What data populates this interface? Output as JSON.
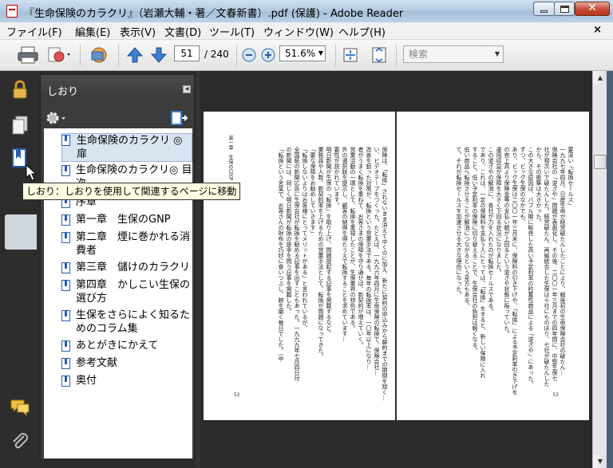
{
  "window": {
    "title": "『生命保険のカラクリ』（岩瀬大輔・著／文春新書）.pdf (保護) - Adobe Reader"
  },
  "menu": {
    "items": [
      "ファイル(F)",
      "編集(E)",
      "表示(V)",
      "文書(D)",
      "ツール(T)",
      "ウィンドウ(W)",
      "ヘルプ(H)"
    ],
    "close_glyph": "×"
  },
  "toolbar": {
    "current_page": "51",
    "page_total": "/ 240",
    "zoom": "51.6%",
    "search_placeholder": "検索"
  },
  "bookmarks_panel": {
    "title": "しおり",
    "items": [
      {
        "label": "生命保険のカラクリ ◎ 扉",
        "selected": true
      },
      {
        "label": "生命保険のカラクリ◎ 目次"
      },
      {
        "label": "序章"
      },
      {
        "label": "第一章　生保のGNP"
      },
      {
        "label": "第二章　煙に巻かれる消費者"
      },
      {
        "label": "第三章　儲けのカラクリ"
      },
      {
        "label": "第四章　かしこい生保の選び方"
      },
      {
        "label": "生保をさらによく知るためのコラム集"
      },
      {
        "label": "あとがきにかえて"
      },
      {
        "label": "参考文献"
      },
      {
        "label": "奥付"
      }
    ]
  },
  "tooltip": "しおり：しおりを使用して関連するページに移動",
  "document": {
    "left_page": {
      "running_head": "第一章　生保のGNP",
      "page_number": "52",
      "columns": [
        "保険は、「転換」されないまま消えてゆくのに加え、新たに契約の申込みから解約までの期間を短く…",
        "い、ビデオテープをつくった。たとえば、一九九六年四月に生命保険の転換で、保険会社…",
        "改善を狙った対策が、転換という営業手法である。毎年の転換率は、一〇年以上になり…",
        "者がうまく転換を重ねて、お客さまの保障を守り通せば、新契約が増えていく。",
        "営業活動の一環として、転換を重視したことが、生保業界の特色である。",
        "外の選択肢を提示し、顧客の納得を得たうえで転換することを求めています…",
        "要性が説かれています。",
        "明日新聞が生保の「転換」を取り上げ、問題提起する記事を掲載するなど、",
        "業務員や人数、新契約率を上げるための営業手法として、転換が問題になってきた。",
        "",
        "「要な保障をお勧めしていきます」",
        "「転換しないよりはお客様にとってメリットがある」と言われているが、",
        "",
        "全国紙の新聞広告に生保会社が転換を勧める記事を出すこともあった。一九九九年七月四日付",
        "の新聞には、同じく明日新聞が転換の是非を問う記事を掲載した。",
        "「転換という言葉で、お客さんの財布を巧妙に食いつぶし、腕を磨く毎日でした。（中"
      ]
    },
    "right_page": {
      "page_number": "53",
      "columns": [
        "要深い「転換セールス」",
        "一九九七年四月、日産生命が経営破たんしたことにより、戦後初の生命保険会社の破たん…",
        "保険会社の「逆ざや」問題が表面化し、その後、二〇〇一年三月までの四年間に、中堅生保七",
        "社が相次いで破たんした。経営破たん、再編統合した生保は十社にものぼり、七社が破たんした",
        "から、その衝撃は大きかった。",
        "この大きな原因は、バブル期に販売した高い予定利率の貯蓄性商品による「逆ざや」にあった。",
        "ずつ、ビッグ生保のなかでも、",
        "あり、ビッグ生保は二〇〇一年三月末に、保険料の引き下げや、「転換」による予定利率引き下げを",
        "の売上高より保険金等の支払い額が上回るという逆ざや状態に陥っていた。",
        "運用収益が保障を大きく下回る状況になりました。",
        "",
        "この逆ざやの解消に、各社が力を入れたのが転換セールスである。",
        "であり、これは、一定の保険料を支払う人にとっては、「転換」をすると、新しい保険に入れ",
        "すること、低い予定利率の保険に切り替えることで、生保会社の負担は軽くなる。",
        "低い商品へ転換させることが解消につながるという見方もある。",
        "て、それが転換セールスを加速させる大きな理由になった。"
      ]
    }
  }
}
